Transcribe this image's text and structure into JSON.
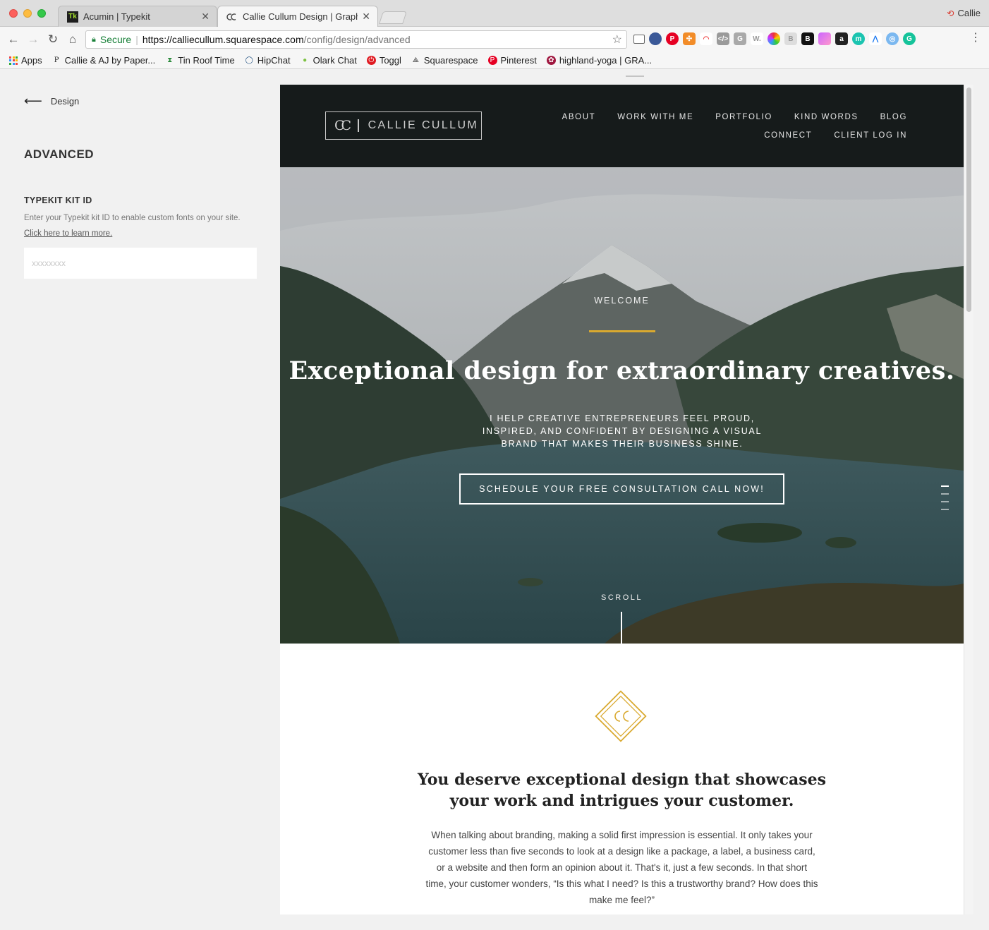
{
  "browser": {
    "tabs": [
      {
        "label": "Acumin | Typekit",
        "active": false
      },
      {
        "label": "Callie Cullum Design | Graphic",
        "active": true
      }
    ],
    "profile_name": "Callie",
    "address": {
      "secure_label": "Secure",
      "url_host": "https://calliecullum.squarespace.com",
      "url_path": "/config/design/advanced"
    },
    "bookmarks": [
      {
        "label": "Apps",
        "icon": "apps-grid-icon"
      },
      {
        "label": "Callie & AJ by Paper...",
        "icon": "paper-icon"
      },
      {
        "label": "Tin Roof Time",
        "icon": "hourglass-icon"
      },
      {
        "label": "HipChat",
        "icon": "chat-bubble-icon"
      },
      {
        "label": "Olark Chat",
        "icon": "green-dot-icon"
      },
      {
        "label": "Toggl",
        "icon": "power-icon"
      },
      {
        "label": "Squarespace",
        "icon": "squarespace-icon"
      },
      {
        "label": "Pinterest",
        "icon": "pinterest-icon"
      },
      {
        "label": "highland-yoga | GRA...",
        "icon": "yoga-icon"
      }
    ]
  },
  "editor": {
    "back_label": "Design",
    "section_title": "ADVANCED",
    "typekit": {
      "label": "TYPEKIT KIT ID",
      "help": "Enter your Typekit kit ID to enable custom fonts on your site.",
      "link": "Click here to learn more.",
      "placeholder": "xxxxxxxx",
      "value": ""
    }
  },
  "site": {
    "logo_text": "CALLIE CULLUM",
    "nav": [
      "ABOUT",
      "WORK WITH ME",
      "PORTFOLIO",
      "KIND WORDS",
      "BLOG",
      "CONNECT",
      "CLIENT LOG IN"
    ],
    "hero": {
      "eyebrow": "WELCOME",
      "title": "Exceptional design for extraordinary creatives.",
      "subtitle": "I HELP CREATIVE ENTREPRENEURS FEEL PROUD, INSPIRED, AND CONFIDENT BY DESIGNING A VISUAL BRAND THAT MAKES THEIR BUSINESS SHINE.",
      "cta": "SCHEDULE YOUR FREE CONSULTATION CALL NOW!",
      "scroll_label": "SCROLL",
      "slide_count": 4,
      "active_slide": 1
    },
    "intro": {
      "heading_line1": "You deserve exceptional design that showcases",
      "heading_line2": "your work and intrigues your customer.",
      "body": "When talking about branding, making a solid first impression is essential. It only takes your customer less than five seconds to look at a design like a package, a label, a business card, or a website and then form an opinion about it. That's it, just a few seconds. In that short time, your customer wonders, “Is this what I need? Is this a trustworthy brand? How does this make me feel?”"
    }
  },
  "colors": {
    "accent_gold": "#d9a92f",
    "header_dark": "#161b1b"
  }
}
